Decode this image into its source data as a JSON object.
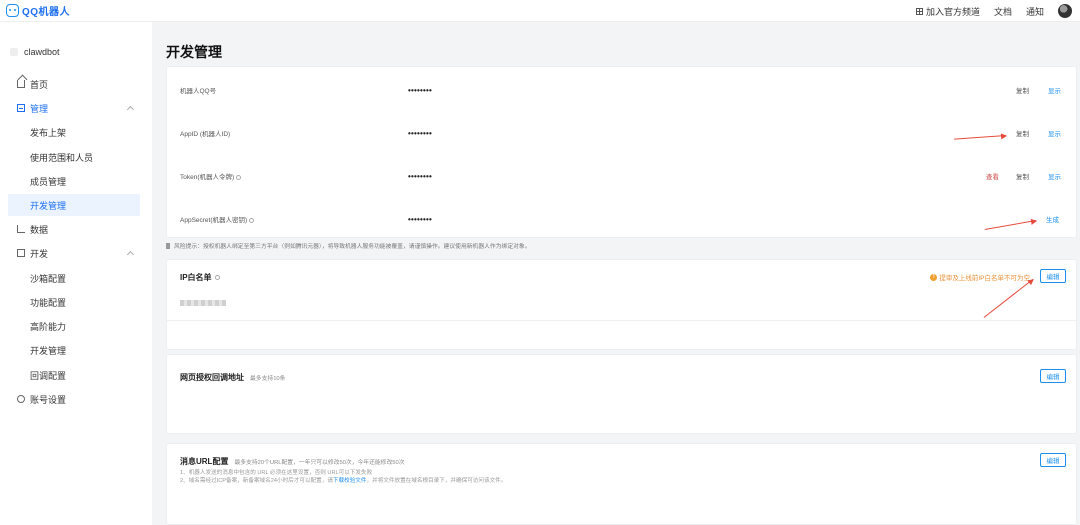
{
  "header": {
    "logo_text": "QQ机器人",
    "links": [
      "加入官方频道",
      "文档",
      "通知"
    ]
  },
  "sidebar": {
    "bot_name": "clawdbot",
    "home": "首页",
    "manage": "管理",
    "manage_items": [
      "发布上架",
      "使用范围和人员",
      "成员管理",
      "开发管理"
    ],
    "data": "数据",
    "dev": "开发",
    "dev_items": [
      "沙箱配置",
      "功能配置",
      "高阶能力",
      "开发管理",
      "回调配置"
    ],
    "account": "账号设置"
  },
  "main": {
    "title": "开发管理",
    "credentials": [
      {
        "label": "机器人QQ号",
        "value": "••••••••",
        "copy": "复制",
        "show": "显示"
      },
      {
        "label": "AppID (机器人ID)",
        "value": "••••••••",
        "copy": "复制",
        "show": "显示"
      },
      {
        "label": "Token(机器人令牌)",
        "value": "••••••••",
        "view": "查看",
        "copy": "复制",
        "show": "显示"
      },
      {
        "label": "AppSecret(机器人密钥)",
        "value": "••••••••",
        "generate": "生成"
      }
    ],
    "risk_notice": "风险提示：授权机器人绑定至第三方平台（例如腾讯元器），将导致机器人服务功能被覆盖，请谨慎操作。建议使用新机器人作为绑定对象。",
    "ip_whitelist": {
      "title": "IP白名单",
      "warning": "提审及上线前IP白名单不可为空",
      "edit": "编辑"
    },
    "oauth_callback": {
      "title": "网页授权回调地址",
      "hint": "最多支持10条",
      "edit": "编辑"
    },
    "message_url": {
      "title": "消息URL配置",
      "hint": "最多支持20个URL配置，一年只可以修改50次，今年还能修改50次",
      "note1": "1、机器人发送的消息中包含的 URL 必须在这里设置，否则 URL可以下发失败",
      "note2_a": "2、域名需经过ICP备案，新备案域名24小时后才可以配置，请",
      "note2_link": "下载校验文件",
      "note2_b": "，并将文件放置在域名根目录下，并确保可访问该文件。",
      "edit": "编辑"
    }
  },
  "colors": {
    "accent": "#1d8ff0",
    "warning": "#e8923a",
    "annotation_arrow": "#e64a3c"
  }
}
